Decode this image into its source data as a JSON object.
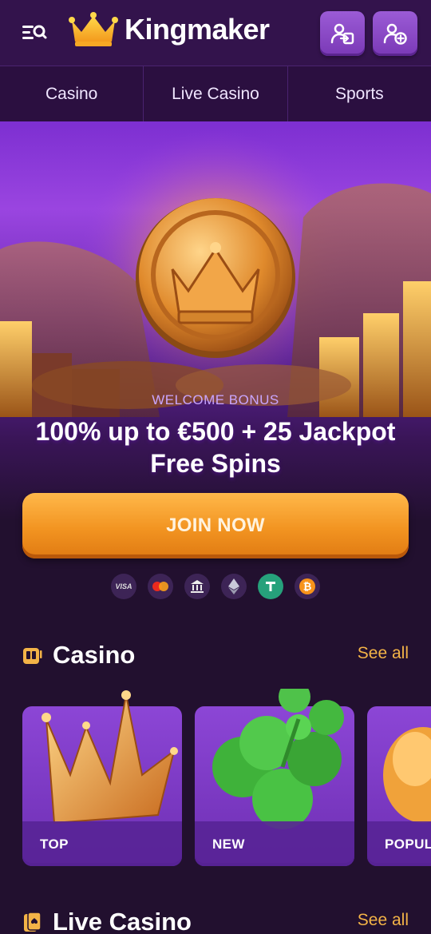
{
  "header": {
    "brand": "Kingmaker",
    "menu_icon": "menu-search-icon",
    "login_icon": "login-icon",
    "register_icon": "add-user-icon"
  },
  "nav": {
    "items": [
      {
        "label": "Casino"
      },
      {
        "label": "Live Casino"
      },
      {
        "label": "Sports"
      }
    ]
  },
  "hero": {
    "eyebrow": "WELCOME BONUS",
    "headline": "100% up to €500 + 25 Jackpot Free Spins",
    "cta": "JOIN NOW",
    "payment_methods": [
      {
        "name": "visa",
        "label": "VISA"
      },
      {
        "name": "mastercard-icon"
      },
      {
        "name": "bank-icon"
      },
      {
        "name": "ethereum-icon"
      },
      {
        "name": "tether-icon"
      },
      {
        "name": "bitcoin-icon"
      }
    ]
  },
  "casino": {
    "title": "Casino",
    "see_all": "See all",
    "categories": [
      {
        "label": "TOP"
      },
      {
        "label": "NEW"
      },
      {
        "label": "POPUL"
      }
    ]
  },
  "live_casino": {
    "title": "Live Casino",
    "see_all": "See all"
  },
  "colors": {
    "background": "#22102f",
    "header": "#33134c",
    "accent_orange": "#f29421",
    "see_all": "#f3b347",
    "card_purple": "#8c46d6"
  }
}
